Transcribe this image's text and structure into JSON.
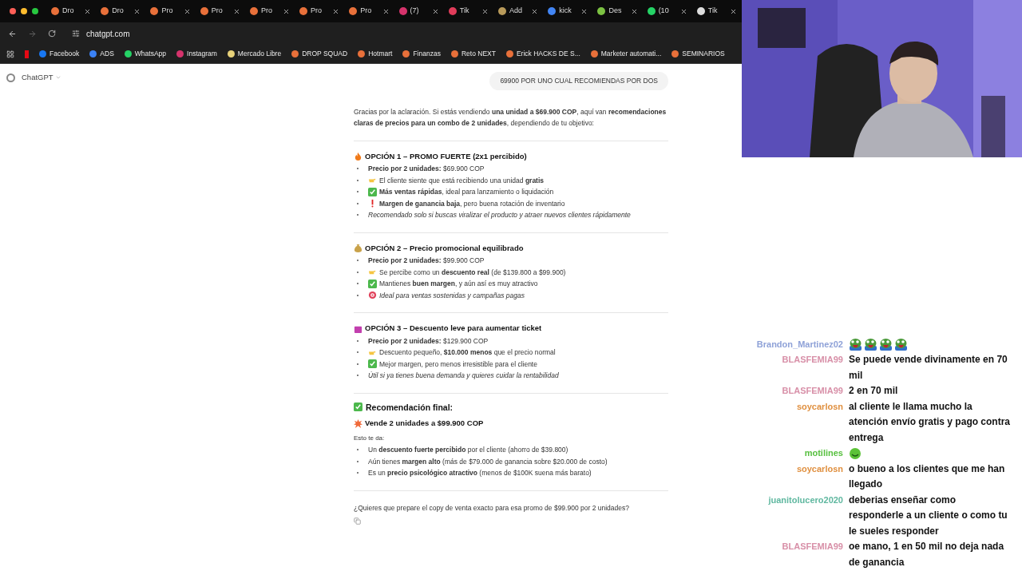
{
  "browser": {
    "tabs": [
      {
        "label": "Dro",
        "color": "#e8703a",
        "selected": false
      },
      {
        "label": "Dro",
        "color": "#e8703a",
        "selected": false
      },
      {
        "label": "Pro",
        "color": "#e8703a",
        "selected": false
      },
      {
        "label": "Pro",
        "color": "#e8703a",
        "selected": false
      },
      {
        "label": "Pro",
        "color": "#e8703a",
        "selected": false
      },
      {
        "label": "Pro",
        "color": "#e8703a",
        "selected": false
      },
      {
        "label": "Pro",
        "color": "#e8703a",
        "selected": false
      },
      {
        "label": "(7)",
        "color": "#d6336c",
        "selected": false
      },
      {
        "label": "Tik",
        "color": "#e03c5a",
        "selected": false
      },
      {
        "label": "Add",
        "color": "#b89a5a",
        "selected": false
      },
      {
        "label": "kick",
        "color": "#4285f4",
        "selected": false
      },
      {
        "label": "Des",
        "color": "#7cc242",
        "selected": false
      },
      {
        "label": "(10",
        "color": "#25d366",
        "selected": false
      },
      {
        "label": "Tik",
        "color": "#dddddd",
        "selected": false
      }
    ],
    "address": "chatgpt.com",
    "bookmarks": [
      {
        "label": "Facebook",
        "color": "#1877f2"
      },
      {
        "label": "ADS",
        "color": "#3b82f6"
      },
      {
        "label": "WhatsApp",
        "color": "#25d366"
      },
      {
        "label": "Instagram",
        "color": "#d6336c"
      },
      {
        "label": "Mercado Libre",
        "color": "#e8d27a"
      },
      {
        "label": "DROP SQUAD",
        "color": "#e8703a"
      },
      {
        "label": "Hotmart",
        "color": "#e8703a"
      },
      {
        "label": "Finanzas",
        "color": "#e8703a"
      },
      {
        "label": "Reto NEXT",
        "color": "#e8703a"
      },
      {
        "label": "Erick HACKS DE S...",
        "color": "#e8703a"
      },
      {
        "label": "Marketer automati...",
        "color": "#e8703a"
      },
      {
        "label": "SEMINARIOS",
        "color": "#e8703a"
      }
    ]
  },
  "app": {
    "name": "ChatGPT"
  },
  "user_message": "69900 POR UNO CUAL RECOMIENDAS POR DOS",
  "response": {
    "intro": "Gracias por la aclaración. Si estás vendiendo **una unidad a $69.900 COP**, aquí van **recomendaciones claras de precios para un combo de 2 unidades**, dependiendo de tu objetivo:",
    "sections": [
      {
        "kind": "fire",
        "title": "OPCIÓN 1 – PROMO FUERTE (2x1 percibido)",
        "items": [
          {
            "kind": "plain",
            "text": "**Precio por 2 unidades:** $69.900 COP",
            "italic": false
          },
          {
            "kind": "point",
            "text": "El cliente siente que está recibiendo una unidad **gratis**",
            "italic": false
          },
          {
            "kind": "check",
            "text": "**Más ventas rápidas**, ideal para lanzamiento o liquidación",
            "italic": false
          },
          {
            "kind": "exclaim",
            "text": "**Margen de ganancia baja**, pero buena rotación de inventario",
            "italic": false
          },
          {
            "kind": "plain",
            "text": "Recomendado solo si buscas viralizar el producto y atraer nuevos clientes rápidamente",
            "italic": true
          }
        ]
      },
      {
        "kind": "money",
        "title": "OPCIÓN 2 – Precio promocional equilibrado",
        "items": [
          {
            "kind": "plain",
            "text": "**Precio por 2 unidades:** $99.900 COP",
            "italic": false
          },
          {
            "kind": "point",
            "text": "Se percibe como un **descuento real** (de $139.800 a $99.900)",
            "italic": false
          },
          {
            "kind": "check",
            "text": "Mantienes **buen margen**, y aún así es muy atractivo",
            "italic": false
          },
          {
            "kind": "target",
            "text": "Ideal para ventas sostenidas y campañas pagas",
            "italic": true
          }
        ]
      },
      {
        "kind": "bag",
        "title": "OPCIÓN 3 – Descuento leve para aumentar ticket",
        "items": [
          {
            "kind": "plain",
            "text": "**Precio por 2 unidades:** $129.900 COP",
            "italic": false
          },
          {
            "kind": "point",
            "text": "Descuento pequeño, **$10.000 menos** que el precio normal",
            "italic": false
          },
          {
            "kind": "check",
            "text": "Mejor margen, pero menos irresistible para el cliente",
            "italic": false
          },
          {
            "kind": "plain",
            "text": "Útil si ya tienes buena demanda y quieres cuidar la rentabilidad",
            "italic": true
          }
        ]
      }
    ],
    "final": {
      "kind": "check",
      "title": "Recomendación final:",
      "subtitle": {
        "kind": "boom",
        "text": "Vende 2 unidades a $99.900 COP"
      },
      "lead": "Esto te da:",
      "items": [
        "Un **descuento fuerte percibido** por el cliente (ahorro de $39.800)",
        "Aún tienes **margen alto** (más de $79.000 de ganancia sobre $20.000 de costo)",
        "Es un **precio psicológico atractivo** (menos de $100K suena más barato)"
      ]
    },
    "question": "¿Quieres que prepare el copy de venta exacto para esa promo de $99.900 por 2 unidades?"
  },
  "chat": [
    {
      "user": "Brandon_Martinez02",
      "color": "#8fa2d8",
      "kind": "emotes",
      "emotes": [
        {
          "kind": "frog"
        },
        {
          "kind": "frog"
        },
        {
          "kind": "frog"
        },
        {
          "kind": "frog"
        }
      ]
    },
    {
      "user": "BLASFEMIA99",
      "color": "#d890a8",
      "kind": "text",
      "text": "Se puede vende divinamente en 70 mil"
    },
    {
      "user": "BLASFEMIA99",
      "color": "#d890a8",
      "kind": "text",
      "text": "2 en 70 mil"
    },
    {
      "user": "soycarlosn",
      "color": "#e09040",
      "kind": "text",
      "text": "al cliente le llama mucho la atención envío gratis y pago contra entrega"
    },
    {
      "user": "motilines",
      "color": "#58c040",
      "kind": "emotes",
      "emotes": [
        {
          "kind": "smile"
        }
      ]
    },
    {
      "user": "soycarlosn",
      "color": "#e09040",
      "kind": "text",
      "text": "o bueno a los clientes que me han llegado"
    },
    {
      "user": "juanitolucero2020",
      "color": "#60b8a0",
      "kind": "text",
      "text": "deberias enseñar como responderle a un cliente o como tu le sueles responder"
    },
    {
      "user": "BLASFEMIA99",
      "color": "#d890a8",
      "kind": "text",
      "text": "oe mano, 1 en 50 mil no deja nada de ganancia"
    }
  ]
}
